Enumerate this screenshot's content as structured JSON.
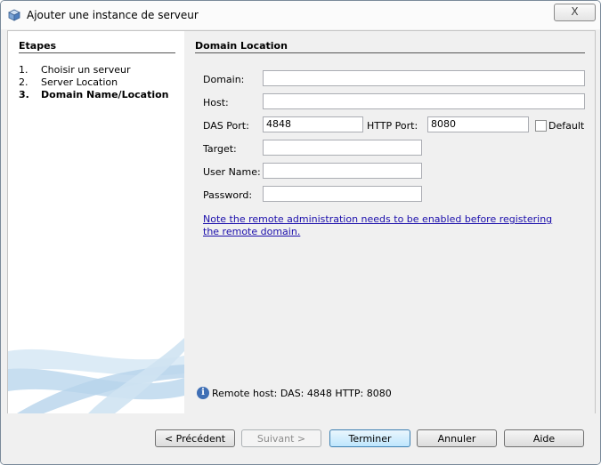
{
  "window": {
    "title": "Ajouter une instance de serveur",
    "close_glyph": "X"
  },
  "steps": {
    "title": "Etapes",
    "items": [
      {
        "num": "1.",
        "label": "Choisir un serveur"
      },
      {
        "num": "2.",
        "label": "Server Location"
      },
      {
        "num": "3.",
        "label": "Domain Name/Location"
      }
    ]
  },
  "main": {
    "title": "Domain Location",
    "fields": {
      "domain_label": "Domain:",
      "domain_value": "",
      "host_label": "Host:",
      "host_value": "",
      "das_port_label": "DAS Port:",
      "das_port_value": "4848",
      "http_port_label": "HTTP Port:",
      "http_port_value": "8080",
      "default_label": "Default",
      "target_label": "Target:",
      "target_value": "",
      "username_label": "User Name:",
      "username_value": "",
      "password_label": "Password:",
      "password_value": ""
    },
    "note_link": "Note the remote administration needs to be enabled before registering the remote domain.",
    "info_glyph": "i",
    "remote_host": "Remote host:  DAS: 4848 HTTP: 8080"
  },
  "buttons": {
    "previous": "< Précédent",
    "next": "Suivant >",
    "finish": "Terminer",
    "cancel": "Annuler",
    "help": "Aide"
  }
}
